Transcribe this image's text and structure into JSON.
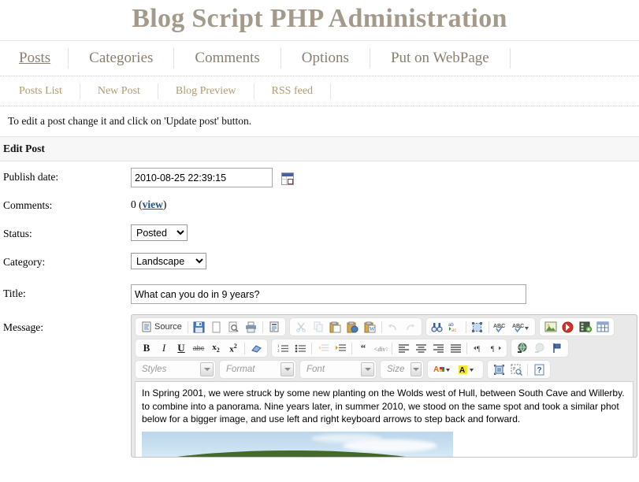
{
  "header": {
    "title": "Blog Script PHP Administration"
  },
  "main_nav": {
    "items": [
      {
        "label": "Posts",
        "active": true
      },
      {
        "label": "Categories",
        "active": false
      },
      {
        "label": "Comments",
        "active": false
      },
      {
        "label": "Options",
        "active": false
      },
      {
        "label": "Put on WebPage",
        "active": false
      }
    ]
  },
  "sub_nav": {
    "items": [
      {
        "label": "Posts List"
      },
      {
        "label": "New Post"
      },
      {
        "label": "Blog Preview"
      },
      {
        "label": "RSS feed"
      }
    ]
  },
  "hint": "To edit a post change it and click on 'Update post' button.",
  "section": {
    "title": "Edit Post"
  },
  "form": {
    "publish_date": {
      "label": "Publish date:",
      "value": "2010-08-25 22:39:15"
    },
    "comments": {
      "label": "Comments:",
      "count": "0",
      "view_link": "view",
      "open_paren": "(",
      "close_paren": ")"
    },
    "status": {
      "label": "Status:",
      "value": "Posted",
      "options": [
        "Posted"
      ]
    },
    "category": {
      "label": "Category:",
      "value": "Landscape",
      "options": [
        "Landscape"
      ]
    },
    "title_field": {
      "label": "Title:",
      "value": "What can you do in 9 years?",
      "placeholder": ""
    },
    "message": {
      "label": "Message:"
    }
  },
  "editor": {
    "toolbar_row1": [
      {
        "name": "source",
        "label": "Source",
        "icon": "source-icon"
      },
      {
        "name": "save",
        "label": "",
        "icon": "save-icon"
      },
      {
        "name": "new-page",
        "label": "",
        "icon": "new-page-icon"
      },
      {
        "name": "preview",
        "label": "",
        "icon": "preview-icon"
      },
      {
        "name": "print",
        "label": "",
        "icon": "print-icon"
      },
      {
        "name": "templates",
        "label": "",
        "icon": "templates-icon"
      },
      {
        "name": "cut",
        "label": "",
        "icon": "scissors-icon"
      },
      {
        "name": "copy",
        "label": "",
        "icon": "copy-icon"
      },
      {
        "name": "paste",
        "label": "",
        "icon": "paste-icon"
      },
      {
        "name": "paste-text",
        "label": "",
        "icon": "paste-text-icon"
      },
      {
        "name": "paste-word",
        "label": "",
        "icon": "paste-word-icon"
      },
      {
        "name": "undo",
        "label": "",
        "icon": "undo-icon"
      },
      {
        "name": "redo",
        "label": "",
        "icon": "redo-icon"
      },
      {
        "name": "find",
        "label": "",
        "icon": "binoculars-icon"
      },
      {
        "name": "replace",
        "label": "",
        "icon": "replace-icon"
      },
      {
        "name": "select-all",
        "label": "",
        "icon": "select-all-icon"
      },
      {
        "name": "spellcheck",
        "label": "",
        "icon": "spellcheck-icon"
      },
      {
        "name": "scayt",
        "label": "",
        "icon": "scayt-icon"
      },
      {
        "name": "image",
        "label": "",
        "icon": "image-icon"
      },
      {
        "name": "flash",
        "label": "",
        "icon": "flash-icon"
      },
      {
        "name": "media",
        "label": "",
        "icon": "media-icon"
      },
      {
        "name": "table",
        "label": "",
        "icon": "table-icon"
      }
    ],
    "toolbar_row2": [
      {
        "name": "bold",
        "label": "B",
        "icon": "bold-icon"
      },
      {
        "name": "italic",
        "label": "I",
        "icon": "italic-icon"
      },
      {
        "name": "underline",
        "label": "U",
        "icon": "underline-icon"
      },
      {
        "name": "strike",
        "label": "abc",
        "icon": "strikethrough-icon"
      },
      {
        "name": "subscript",
        "label": "x2",
        "icon": "subscript-icon"
      },
      {
        "name": "superscript",
        "label": "x2",
        "icon": "superscript-icon"
      },
      {
        "name": "remove-format",
        "label": "",
        "icon": "eraser-icon"
      },
      {
        "name": "numbered-list",
        "label": "",
        "icon": "numbered-list-icon"
      },
      {
        "name": "bulleted-list",
        "label": "",
        "icon": "bulleted-list-icon"
      },
      {
        "name": "outdent",
        "label": "",
        "icon": "outdent-icon"
      },
      {
        "name": "indent",
        "label": "",
        "icon": "indent-icon"
      },
      {
        "name": "blockquote",
        "label": "",
        "icon": "blockquote-icon"
      },
      {
        "name": "create-div",
        "label": "",
        "icon": "create-div-icon"
      },
      {
        "name": "align-left",
        "label": "",
        "icon": "align-left-icon"
      },
      {
        "name": "align-center",
        "label": "",
        "icon": "align-center-icon"
      },
      {
        "name": "align-right",
        "label": "",
        "icon": "align-right-icon"
      },
      {
        "name": "align-justify",
        "label": "",
        "icon": "align-justify-icon"
      },
      {
        "name": "ltr",
        "label": "",
        "icon": "text-direction-ltr-icon"
      },
      {
        "name": "rtl",
        "label": "",
        "icon": "text-direction-rtl-icon"
      },
      {
        "name": "link",
        "label": "",
        "icon": "link-icon"
      },
      {
        "name": "unlink",
        "label": "",
        "icon": "unlink-icon"
      },
      {
        "name": "anchor",
        "label": "",
        "icon": "anchor-flag-icon"
      }
    ],
    "selects": [
      {
        "name": "styles",
        "label": "Styles"
      },
      {
        "name": "format",
        "label": "Format"
      },
      {
        "name": "font",
        "label": "Font"
      },
      {
        "name": "size",
        "label": "Size"
      }
    ],
    "toolbar_row3_buttons": [
      {
        "name": "text-color",
        "label": "A",
        "icon": "text-color-icon"
      },
      {
        "name": "bg-color",
        "label": "A",
        "icon": "bg-color-icon"
      },
      {
        "name": "maximize",
        "label": "",
        "icon": "maximize-icon"
      },
      {
        "name": "show-blocks",
        "label": "",
        "icon": "show-blocks-icon"
      },
      {
        "name": "about",
        "label": "?",
        "icon": "about-icon"
      }
    ],
    "content": {
      "paragraph_line1": "In Spring 2001, we were struck by some new planting on the Wolds west of Hull, between South Cave and Willerby.",
      "paragraph_line2": "to combine into a panorama. Nine years later, in summer 2010, we stood on the same spot and took a similar phot",
      "paragraph_line3": "below for a bigger image, and use left and right keyboard arrows to step back and forward."
    }
  },
  "colors": {
    "title": "#a39a8c",
    "main_nav": "#8a7f70",
    "sub_nav": "#b49a6b",
    "link": "#1a4f8a"
  }
}
